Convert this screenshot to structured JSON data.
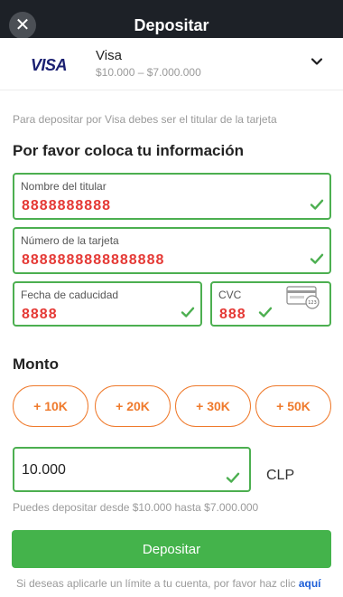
{
  "header": {
    "title": "Depositar",
    "close_icon": "close-icon"
  },
  "method": {
    "logo_text": "VISA",
    "name": "Visa",
    "range": "$10.000 – $7.000.000",
    "expand_icon": "chevron-down-icon"
  },
  "note": "Para depositar por Visa debes ser el titular de la tarjeta",
  "form": {
    "title": "Por favor coloca tu información",
    "name_label": "Nombre del titular",
    "name_value": "8888888888",
    "card_label": "Número de la tarjeta",
    "card_value": "8888888888888888",
    "expiry_label": "Fecha de caducidad",
    "expiry_value": "8888",
    "cvc_label": "CVC",
    "cvc_value": "888"
  },
  "amount": {
    "title": "Monto",
    "chips": [
      "+ 10K",
      "+ 20K",
      "+ 30K",
      "+ 50K"
    ],
    "value": "10.000",
    "currency": "CLP",
    "hint": "Puedes depositar desde $10.000 hasta $7.000.000"
  },
  "submit_label": "Depositar",
  "footer": {
    "text": "Si deseas aplicarle un límite a tu cuenta, por favor haz clic ",
    "link": "aquí"
  },
  "colors": {
    "topbar": "#1d2127",
    "valid": "#4caf50",
    "accent": "#ef7a2c",
    "button": "#44b34b",
    "link": "#1e5fd8",
    "masked_value": "#e53935"
  }
}
